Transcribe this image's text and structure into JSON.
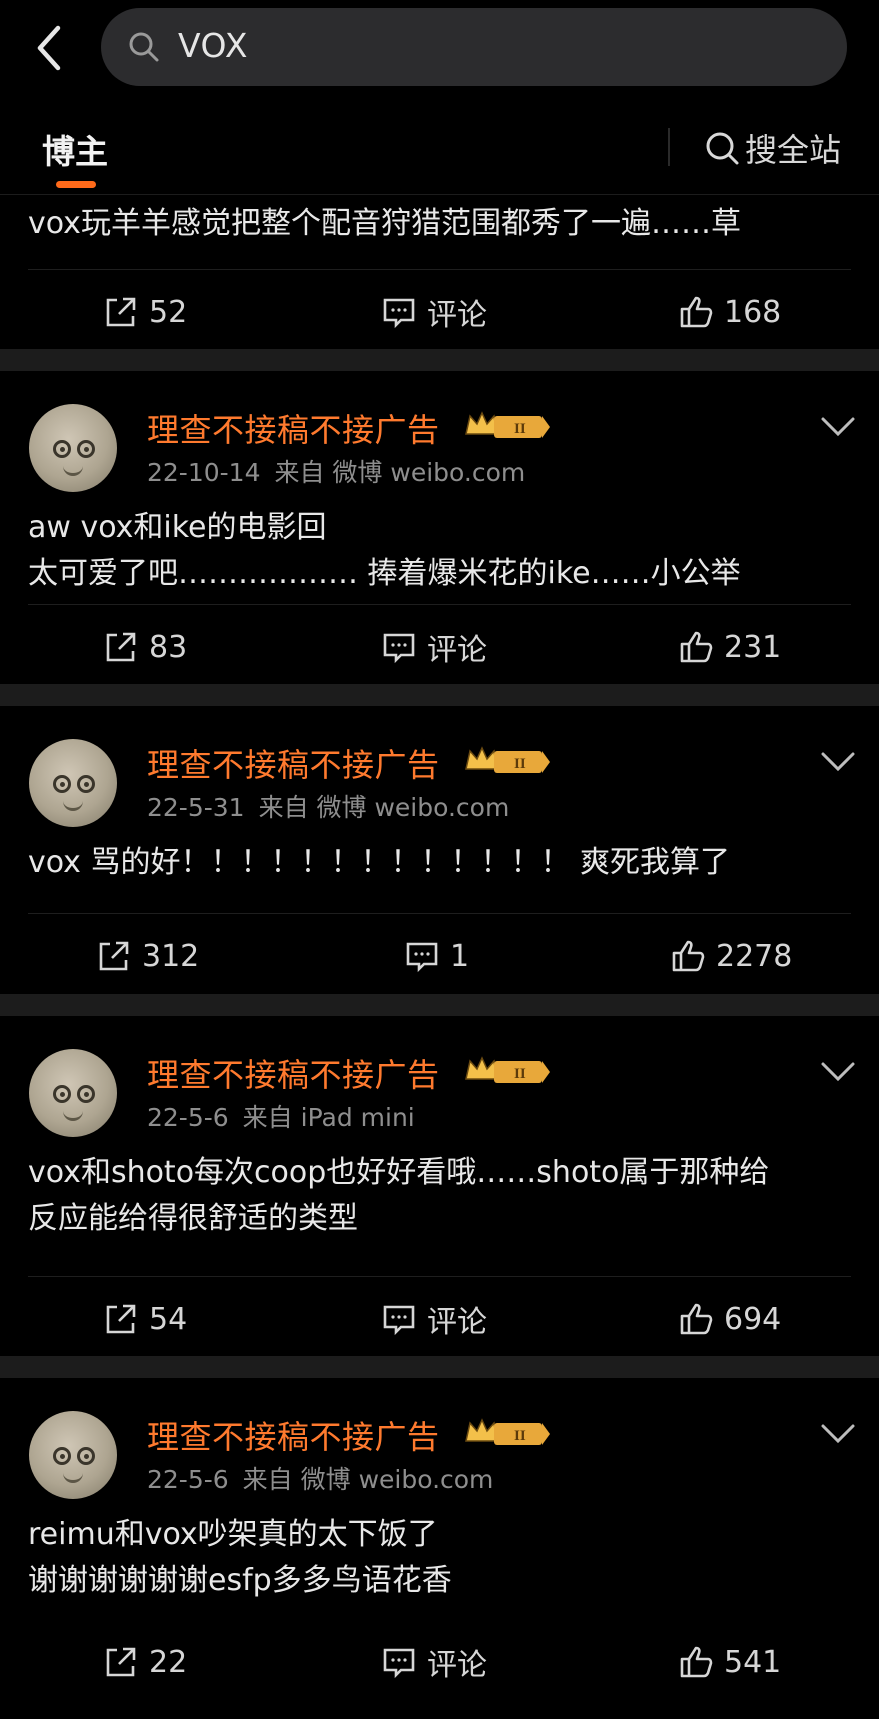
{
  "search": {
    "query": "VOX"
  },
  "tabs": {
    "bozhu": "博主",
    "search_all": "搜全站"
  },
  "posts": [
    {
      "text_lines": [
        "vox玩羊羊感觉把整个配音狩猎范围都秀了一遍……草"
      ],
      "reposts": "52",
      "comments": "评论",
      "likes": "168"
    },
    {
      "author": "理查不接稿不接广告",
      "badge": "II",
      "date": "22-10-14",
      "source": "来自 微博 weibo.com",
      "text_lines": [
        "aw vox和ike的电影回",
        "太可爱了吧……………… 捧着爆米花的ike……小公举"
      ],
      "reposts": "83",
      "comments": "评论",
      "likes": "231"
    },
    {
      "author": "理查不接稿不接广告",
      "badge": "II",
      "date": "22-5-31",
      "source": "来自 微博 weibo.com",
      "text_lines": [
        "vox 骂的好！！！！！！！！！！！！！ 爽死我算了"
      ],
      "reposts": "312",
      "comments": "1",
      "likes": "2278"
    },
    {
      "author": "理查不接稿不接广告",
      "badge": "II",
      "date": "22-5-6",
      "source": "来自 iPad mini",
      "text_lines": [
        "vox和shoto每次coop也好好看哦……shoto属于那种给",
        "反应能给得很舒适的类型"
      ],
      "reposts": "54",
      "comments": "评论",
      "likes": "694"
    },
    {
      "author": "理查不接稿不接广告",
      "badge": "II",
      "date": "22-5-6",
      "source": "来自 微博 weibo.com",
      "text_lines": [
        "reimu和vox吵架真的太下饭了",
        "谢谢谢谢谢谢esfp多多鸟语花香"
      ],
      "reposts": "22",
      "comments": "评论",
      "likes": "541"
    }
  ],
  "colors": {
    "accent": "#ff6a1a",
    "author": "#ff7a2e",
    "background": "#000000",
    "separator": "#1c1c1c"
  }
}
